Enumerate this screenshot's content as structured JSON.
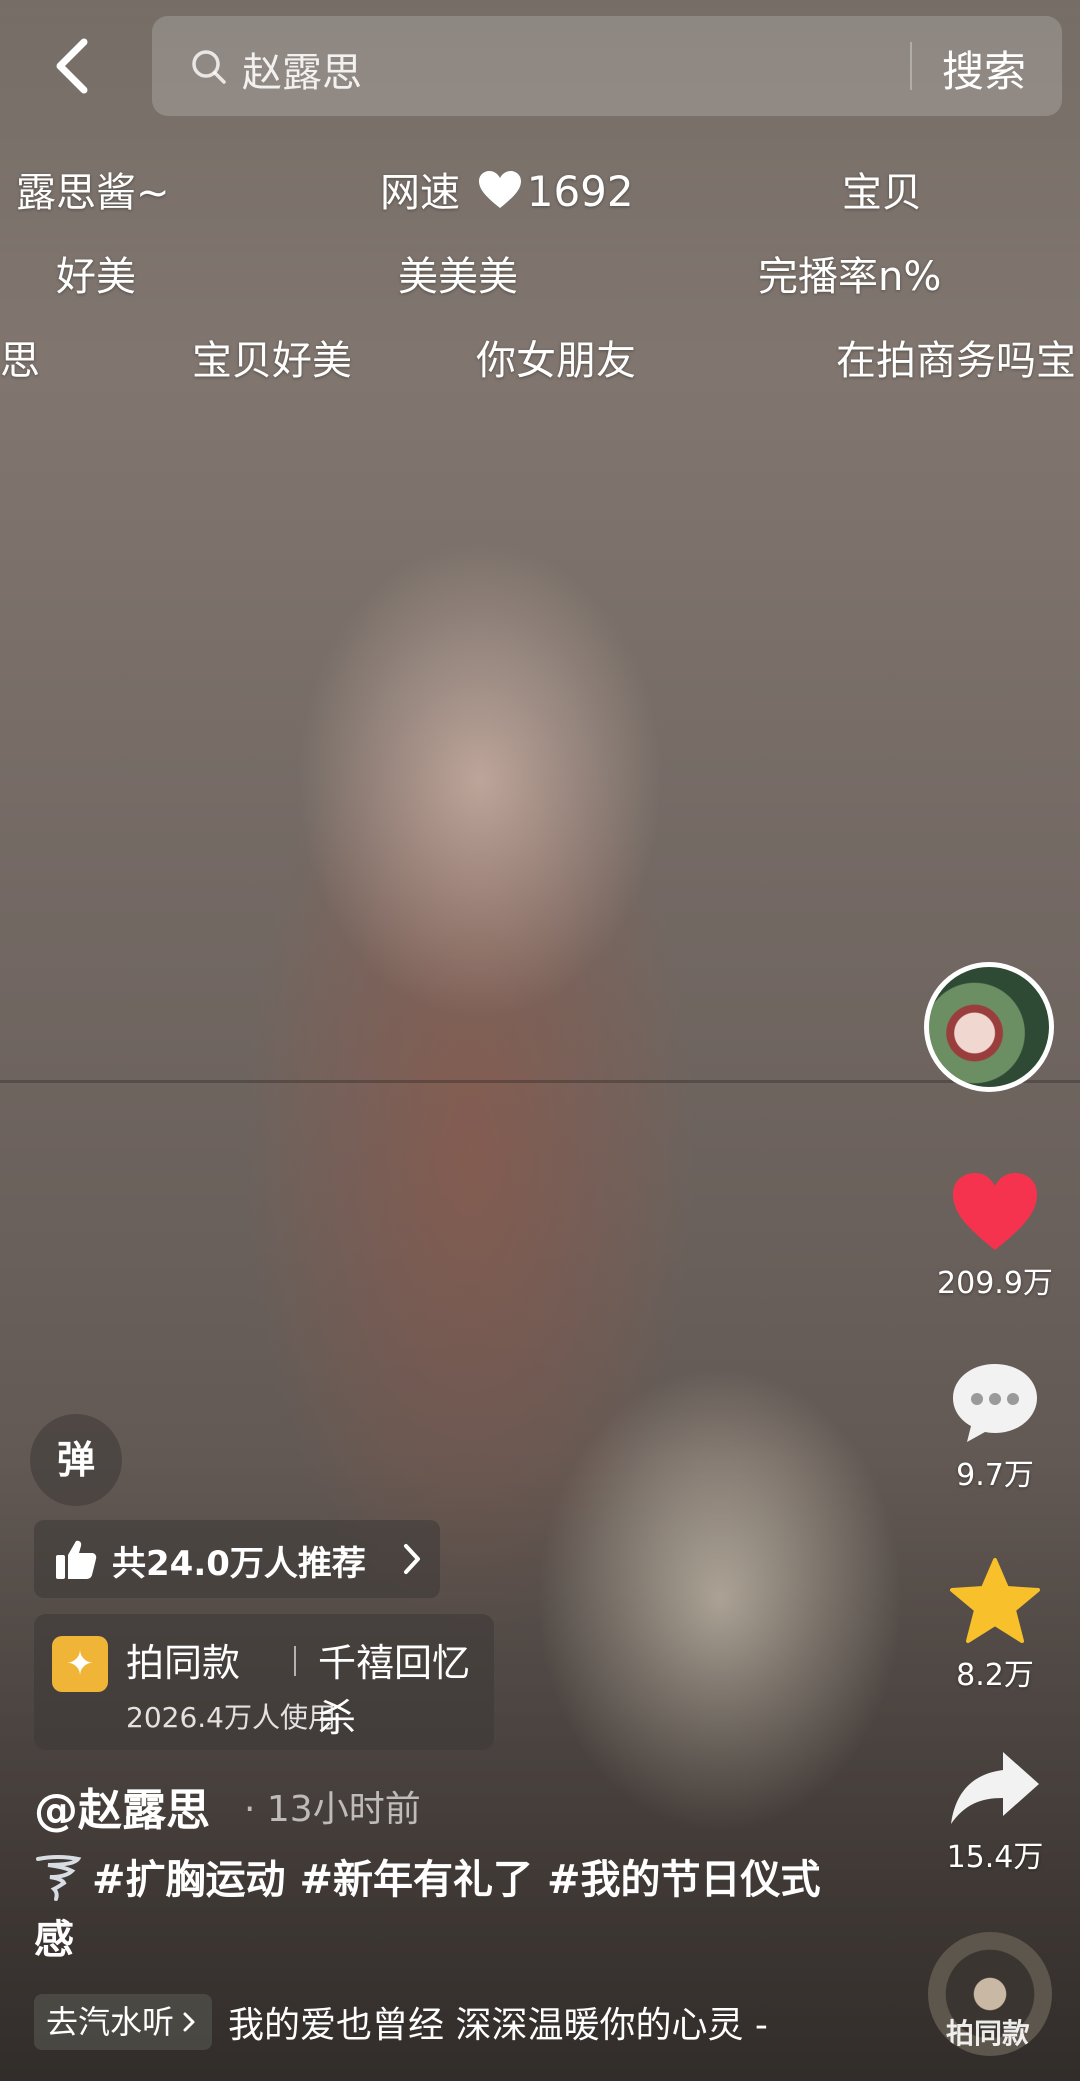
{
  "search": {
    "query": "赵露思",
    "button_label": "搜索"
  },
  "danmaku": [
    "露思酱~",
    "网速",
    "1692",
    "宝贝",
    "好美",
    "美美美",
    "完播率n%",
    "露思",
    "宝贝好美",
    "你女朋友",
    "在拍商务吗宝"
  ],
  "right_rail": {
    "likes": "209.9万",
    "comments": "9.7万",
    "favorites": "8.2万",
    "shares": "15.4万",
    "music_disc_label": "拍同款"
  },
  "danmaku_toggle_label": "弹",
  "recommend": {
    "text": "共24.0万人推荐"
  },
  "effect": {
    "title": "拍同款",
    "name": "千禧回忆杀",
    "usage": "2026.4万人使用"
  },
  "author": "@赵露思",
  "post_time": "· 13小时前",
  "hashtags": [
    "#扩胸运动",
    "#新年有礼了",
    "#我的节日仪式感"
  ],
  "music": {
    "link_label": "去汽水听",
    "title": "我的爱也曾经 深深温暖你的心灵 -"
  },
  "colors": {
    "like_red": "#f5334f",
    "favorite_yellow": "#f8c02a",
    "effect_icon": "#f0b437"
  }
}
